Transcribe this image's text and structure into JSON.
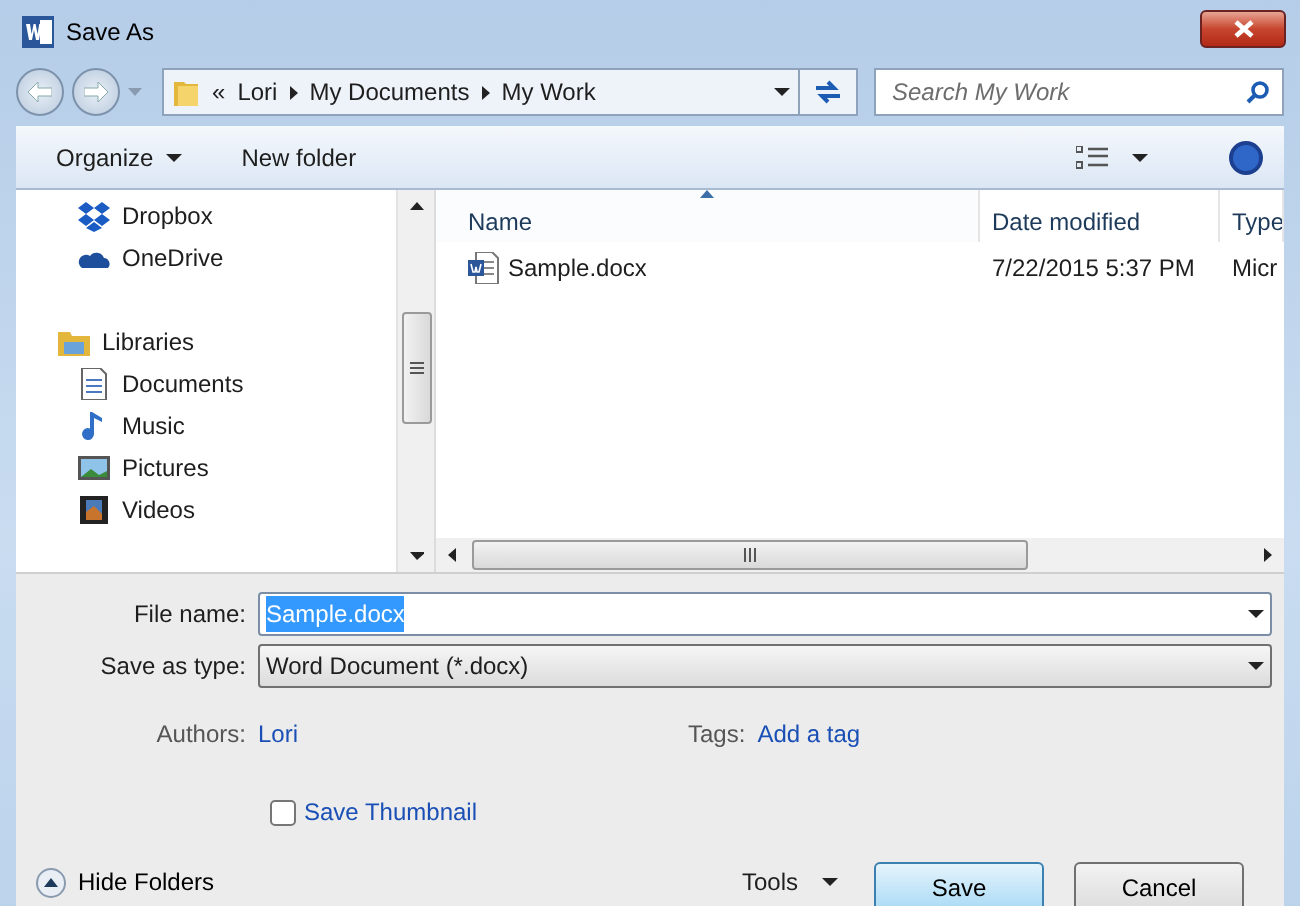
{
  "window": {
    "title": "Save As"
  },
  "address": {
    "overflow": "«",
    "crumbs": [
      "Lori",
      "My Documents",
      "My Work"
    ]
  },
  "search": {
    "placeholder": "Search My Work"
  },
  "toolbar": {
    "buttons": [
      {
        "label": "Organize",
        "dropdown": true
      },
      {
        "label": "New folder",
        "dropdown": false
      }
    ]
  },
  "nav": [
    {
      "label": "Dropbox",
      "kind": "dropbox"
    },
    {
      "label": "OneDrive",
      "kind": "onedrive"
    },
    {
      "label": "Libraries",
      "kind": "library",
      "children": [
        {
          "label": "Documents",
          "kind": "documents"
        },
        {
          "label": "Music",
          "kind": "music"
        },
        {
          "label": "Pictures",
          "kind": "pictures"
        },
        {
          "label": "Videos",
          "kind": "videos"
        }
      ]
    }
  ],
  "files": {
    "columns": [
      {
        "label": "Name",
        "sorted": true
      },
      {
        "label": "Date modified",
        "sorted": false
      },
      {
        "label": "Type",
        "sorted": false
      }
    ],
    "rows": [
      {
        "name": "Sample.docx",
        "date": "7/22/2015 5:37 PM",
        "type": "Micr"
      }
    ]
  },
  "form": {
    "file_name": {
      "label": "File name:",
      "value": "Sample.docx",
      "selected": true
    },
    "save_as_type": {
      "label": "Save as type:",
      "value": "Word Document (*.docx)"
    },
    "authors": {
      "label": "Authors:",
      "value": "Lori"
    },
    "tags": {
      "label": "Tags:",
      "value": "Add a tag"
    },
    "save_thumbnail": {
      "label": "Save Thumbnail",
      "checked": false
    }
  },
  "footer": {
    "hide_folders": "Hide Folders",
    "tools": "Tools",
    "buttons": [
      {
        "label": "Save",
        "default": true
      },
      {
        "label": "Cancel",
        "default": false
      }
    ]
  }
}
